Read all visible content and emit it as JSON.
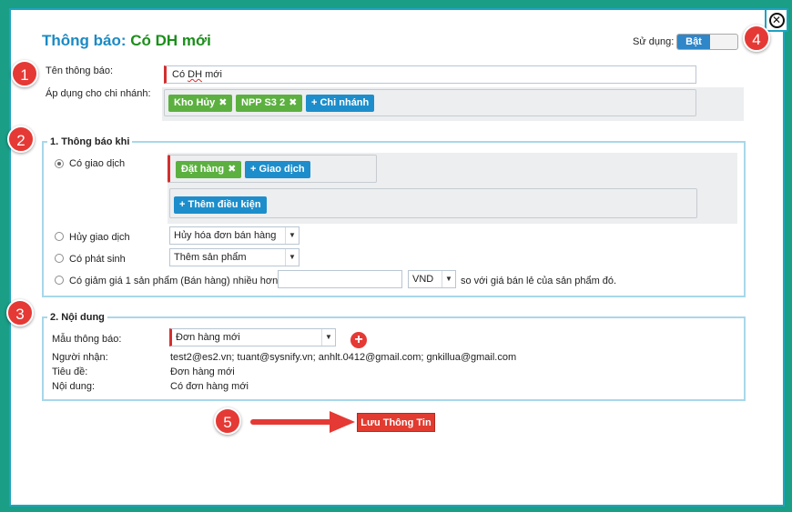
{
  "header": {
    "title_prefix": "Thông báo:",
    "title_highlight": "Có DH mới",
    "usage_label": "Sử dụng:",
    "toggle_on_label": "Bật"
  },
  "form": {
    "name_label": "Tên thông báo:",
    "name_value_prefix": "Có ",
    "name_value_underlined": "DH",
    "name_value_suffix": " mới",
    "branch_label": "Áp dụng cho chi nhánh:",
    "branch_tags": [
      "Kho Hủy",
      "NPP S3 2"
    ],
    "add_branch_label": "+ Chi nhánh"
  },
  "section1": {
    "legend": "1. Thông báo khi",
    "opt_transaction_label": "Có giao dịch",
    "transaction_tags": [
      "Đặt hàng"
    ],
    "add_transaction_label": "+ Giao dịch",
    "add_condition_label": "+ Thêm điều kiện",
    "opt_cancel_label": "Hủy giao dịch",
    "cancel_select_value": "Hủy hóa đơn bán hàng",
    "opt_arise_label": "Có phát sinh",
    "arise_select_value": "Thêm sản phẩm",
    "opt_discount_label": "Có giảm giá 1 sản phẩm (Bán hàng) nhiều hơn",
    "discount_value": "",
    "currency_value": "VND",
    "discount_suffix": "so với giá bán lẻ của sản phẩm đó."
  },
  "section2": {
    "legend": "2. Nội dung",
    "template_label": "Mẫu thông báo:",
    "template_value": "Đơn hàng mới",
    "recipient_label": "Người nhận:",
    "recipient_value": "test2@es2.vn; tuant@sysnify.vn; anhlt.0412@gmail.com; gnkillua@gmail.com",
    "subject_label": "Tiêu đề:",
    "subject_value": "Đơn hàng mới",
    "content_label": "Nội dung:",
    "content_value": "Có đơn hàng mới"
  },
  "actions": {
    "save_label": "Lưu Thông Tin"
  },
  "callouts": [
    "1",
    "2",
    "3",
    "4",
    "5"
  ],
  "colors": {
    "frame": "#1a9e86",
    "title_blue": "#1a8ac4",
    "title_green": "#1b8f1b",
    "tag_green": "#5cb040",
    "tag_blue": "#1d8ecb",
    "callout_red": "#e53935",
    "save_red": "#e23b2f"
  },
  "icons": {
    "close": "close-icon",
    "add_template": "plus-circle-icon",
    "arrow": "arrow-right-icon"
  }
}
